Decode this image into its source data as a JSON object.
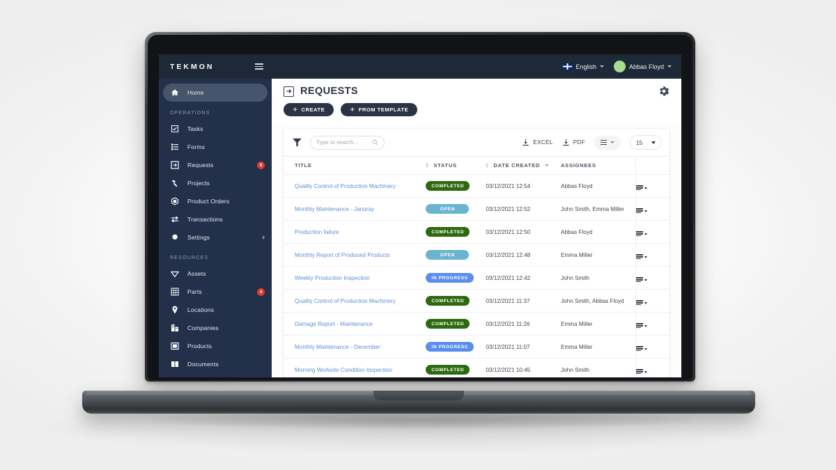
{
  "topbar": {
    "brand": "TEKMON",
    "menu_icon": "hamburger-icon",
    "language": "English",
    "user_name": "Abbas Floyd"
  },
  "sidebar": {
    "primary": [
      {
        "label": "Home",
        "icon": "home-icon",
        "active": true
      }
    ],
    "sections": [
      {
        "title": "OPERATIONS",
        "items": [
          {
            "label": "Tasks",
            "icon": "task-check-icon",
            "badge": ""
          },
          {
            "label": "Forms",
            "icon": "forms-list-icon",
            "badge": ""
          },
          {
            "label": "Requests",
            "icon": "requests-arrow-icon",
            "badge": "8"
          },
          {
            "label": "Projects",
            "icon": "hammer-icon",
            "badge": ""
          },
          {
            "label": "Product Orders",
            "icon": "package-icon",
            "badge": ""
          },
          {
            "label": "Transactions",
            "icon": "transfer-arrows-icon",
            "badge": ""
          },
          {
            "label": "Settings",
            "icon": "gear-icon",
            "badge": "",
            "chevron": true
          }
        ]
      },
      {
        "title": "RESOURCES",
        "items": [
          {
            "label": "Assets",
            "icon": "diamond-icon",
            "badge": ""
          },
          {
            "label": "Parts",
            "icon": "grid-parts-icon",
            "badge": "4"
          },
          {
            "label": "Locations",
            "icon": "map-pin-icon",
            "badge": ""
          },
          {
            "label": "Companies",
            "icon": "building-icon",
            "badge": ""
          },
          {
            "label": "Products",
            "icon": "box-icon",
            "badge": ""
          },
          {
            "label": "Documents",
            "icon": "book-icon",
            "badge": ""
          }
        ]
      }
    ]
  },
  "page": {
    "title": "REQUESTS",
    "title_icon": "arrow-into-box-icon",
    "settings_icon": "gear-icon",
    "buttons": [
      {
        "label": "CREATE",
        "icon": "plus-icon"
      },
      {
        "label": "FROM TEMPLATE",
        "icon": "plus-icon"
      }
    ]
  },
  "toolbar": {
    "filter_icon": "funnel-icon",
    "search_placeholder": "Type to search..",
    "search_value": "",
    "search_icon": "magnifier-icon",
    "excel_label": "EXCEL",
    "pdf_label": "PDF",
    "download_icon": "download-icon",
    "columns_icon": "columns-menu-icon",
    "page_size": "15"
  },
  "table": {
    "columns": [
      {
        "label": "TITLE",
        "sort": "both"
      },
      {
        "label": "STATUS",
        "sort": "both"
      },
      {
        "label": "DATE CREATED",
        "sort": "desc"
      },
      {
        "label": "ASSIGNEES",
        "sort": "none"
      },
      {
        "label": "",
        "sort": "none"
      }
    ],
    "status_colors": {
      "COMPLETED": "#2d6a0f",
      "OPEN": "#6ab4ce",
      "IN PROGRESS": "#5b8def"
    },
    "row_menu_icon": "row-actions-icon",
    "rows": [
      {
        "title": "Quality Control of Production Machinery",
        "status": "COMPLETED",
        "date": "03/12/2021 12:54",
        "assignees": "Abbas Floyd"
      },
      {
        "title": "Monthly Maintenance - Januray",
        "status": "OPEN",
        "date": "03/12/2021 12:52",
        "assignees": "John Smith, Emma Miller"
      },
      {
        "title": "Production failure",
        "status": "COMPLETED",
        "date": "03/12/2021 12:50",
        "assignees": "Abbas Floyd"
      },
      {
        "title": "Monthly Report of Produced Products",
        "status": "OPEN",
        "date": "03/12/2021 12:48",
        "assignees": "Emma Miller"
      },
      {
        "title": "Weekly Production Inspection",
        "status": "IN PROGRESS",
        "date": "03/12/2021 12:42",
        "assignees": "John Smith"
      },
      {
        "title": "Quality Control of Production Machinery",
        "status": "COMPLETED",
        "date": "03/12/2021 11:37",
        "assignees": "John Smith, Abbas Floyd"
      },
      {
        "title": "Damage Report - Maintenance",
        "status": "COMPLETED",
        "date": "03/12/2021 11:26",
        "assignees": "Emma Miller"
      },
      {
        "title": "Monthly Maintenance - December",
        "status": "IN PROGRESS",
        "date": "03/12/2021 11:07",
        "assignees": "Emma Miller"
      },
      {
        "title": "Morning Worksite Condition Inspection",
        "status": "COMPLETED",
        "date": "03/12/2021 10:45",
        "assignees": "John Smith"
      }
    ]
  },
  "colors": {
    "sidebar_bg": "#22304a",
    "topbar_bg": "#1e2937",
    "accent_dark": "#2b3445",
    "link_blue": "#5e8fd8",
    "badge_red": "#e03a2f"
  }
}
